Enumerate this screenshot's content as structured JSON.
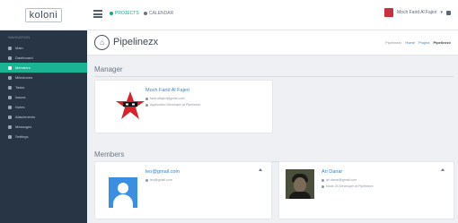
{
  "app": {
    "brand": "koloni"
  },
  "topbar": {
    "tabs": [
      {
        "label": "PROJECTS"
      },
      {
        "label": "CALENDAR"
      }
    ],
    "user_name": "Moch Farid Al Fajeri"
  },
  "sidebar": {
    "header": "NAVIGATION",
    "items": [
      {
        "label": "Main"
      },
      {
        "label": "Dashboard"
      },
      {
        "label": "Members"
      },
      {
        "label": "Milestones"
      },
      {
        "label": "Tasks"
      },
      {
        "label": "Issues"
      },
      {
        "label": "Notes"
      },
      {
        "label": "Attachments"
      },
      {
        "label": "Messages"
      },
      {
        "label": "Settings"
      }
    ],
    "active_index": 2
  },
  "page": {
    "title": "Pipelinezx",
    "breadcrumb": [
      "Pipelinezx",
      "Home",
      "Project",
      "Pipelinezx"
    ]
  },
  "manager": {
    "section_title": "Manager",
    "name": "Moch Farid Al Fajeri",
    "email": "farid.alfajeri@gmail.com",
    "role": "Application Developer at Pipelinezx"
  },
  "members": {
    "section_title": "Members",
    "list": [
      {
        "name": "leo@gmail.com",
        "email": "leo@gmail.com",
        "role": ""
      },
      {
        "name": "Ari Danar",
        "email": "ari.danar@gmail.com",
        "role": "Node JS Developer at Pipelinezx"
      }
    ]
  },
  "colors": {
    "accent": "#1ab394",
    "sidebar_bg": "#283545",
    "link": "#3a7fbd"
  }
}
